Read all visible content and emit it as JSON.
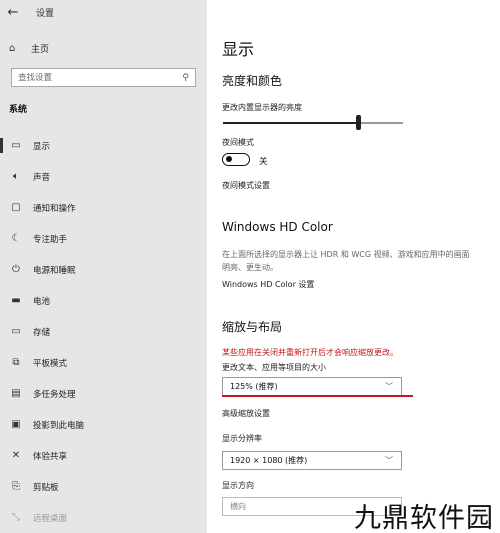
{
  "titlebar": {
    "back_icon": "back-arrow-icon",
    "app_title": "设置"
  },
  "sidebar": {
    "home": {
      "icon": "home-icon",
      "label": "主页"
    },
    "search": {
      "placeholder": "查找设置",
      "icon": "search-icon"
    },
    "section": "系统",
    "items": [
      {
        "icon": "display-icon",
        "label": "显示",
        "selected": true
      },
      {
        "icon": "speaker-icon",
        "label": "声音"
      },
      {
        "icon": "notification-icon",
        "label": "通知和操作"
      },
      {
        "icon": "focus-moon-icon",
        "label": "专注助手"
      },
      {
        "icon": "power-icon",
        "label": "电源和睡眠"
      },
      {
        "icon": "battery-icon",
        "label": "电池"
      },
      {
        "icon": "storage-icon",
        "label": "存储"
      },
      {
        "icon": "tablet-icon",
        "label": "平板模式"
      },
      {
        "icon": "multitask-icon",
        "label": "多任务处理"
      },
      {
        "icon": "projector-icon",
        "label": "投影到此电脑"
      },
      {
        "icon": "shared-experience-icon",
        "label": "体验共享"
      },
      {
        "icon": "clipboard-icon",
        "label": "剪贴板"
      },
      {
        "icon": "remote-desktop-icon",
        "label": "远程桌面"
      }
    ]
  },
  "main": {
    "title": "显示",
    "brightness": {
      "heading": "亮度和颜色",
      "label": "更改内置显示器的亮度",
      "value": 0.75,
      "night_light_label": "夜间模式",
      "night_light_state": "关",
      "night_light_settings": "夜间模式设置"
    },
    "hdr": {
      "heading": "Windows HD Color",
      "description_line1": "在上面所选择的显示器上让 HDR 和 WCG 视频、游戏和应用中的画面",
      "description_line2": "明亮、更生动。",
      "settings_link": "Windows HD Color 设置"
    },
    "scale": {
      "heading": "缩放与布局",
      "warning": "某些应用在关闭并重新打开后才会响应缩放更改。",
      "size_label": "更改文本、应用等项目的大小",
      "size_value": "125% (推荐)",
      "advanced_link": "高级缩放设置",
      "resolution_label": "显示分辨率",
      "resolution_value": "1920 × 1080 (推荐)",
      "orientation_label": "显示方向",
      "orientation_value": "横向"
    }
  },
  "watermark": "九鼎软件园",
  "colors": {
    "sidebar_bg": "#e6e6e6",
    "warning_red": "#c0181c"
  }
}
